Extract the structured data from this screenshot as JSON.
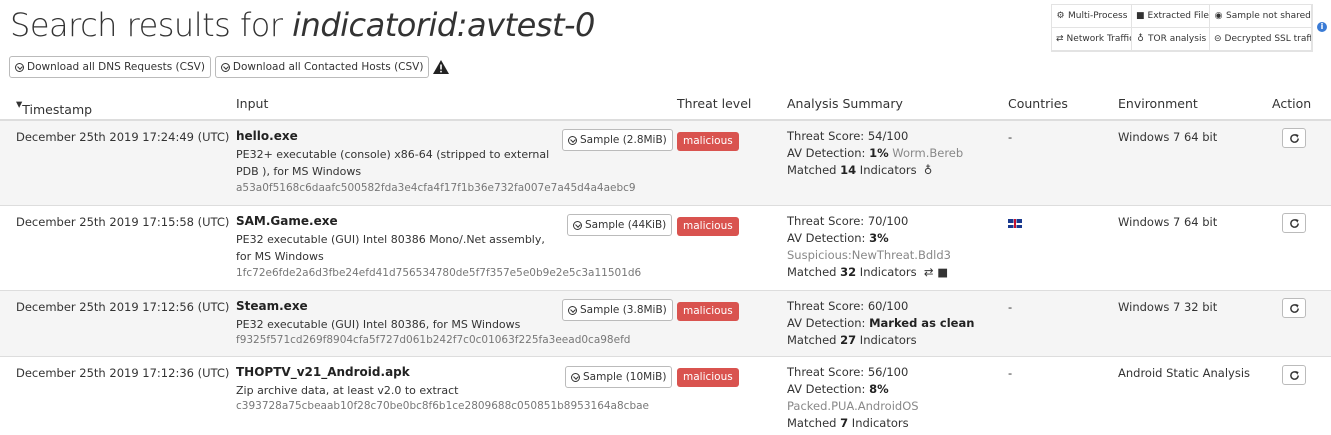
{
  "page": {
    "title_prefix": "Search results for ",
    "title_query": "indicatorid:avtest-0"
  },
  "toolbar": {
    "dns_button": "Download all DNS Requests (CSV)",
    "hosts_button": "Download all Contacted Hosts (CSV)"
  },
  "filters": [
    {
      "label": "Multi-Process",
      "icon": "gears-icon"
    },
    {
      "label": "Extracted Files",
      "icon": "file-icon"
    },
    {
      "label": "Sample not shared",
      "icon": "eye-slash-icon"
    },
    {
      "label": "Network Traffic",
      "icon": "exchange-icon"
    },
    {
      "label": "TOR analysis",
      "icon": "onion-icon"
    },
    {
      "label": "Decrypted SSL traffic",
      "icon": "lock-icon"
    }
  ],
  "table": {
    "headers": {
      "timestamp": "Timestamp",
      "input": "Input",
      "threat": "Threat level",
      "summary": "Analysis Summary",
      "countries": "Countries",
      "environment": "Environment",
      "action": "Action"
    },
    "rows": [
      {
        "timestamp": "December 25th 2019 17:24:49 (UTC)",
        "name": "hello.exe",
        "sample": "Sample (2.8MiB)",
        "desc": "PE32+ executable (console) x86-64 (stripped to external PDB ), for MS Windows",
        "hash": "a53a0f5168c6daafc500582fda3e4cfa4f17f1b36e732fa007e7a45d4a4aebc9",
        "threat": "malicious",
        "score_label": "Threat Score: ",
        "score": "54/100",
        "av_label": "AV Detection: ",
        "av": "1%",
        "av_extra": "Worm.Bereb",
        "matched_pre": "Matched ",
        "matched": "14",
        "matched_post": " Indicators",
        "country": "-",
        "env": "Windows 7 64 bit"
      },
      {
        "timestamp": "December 25th 2019 17:15:58 (UTC)",
        "name": "SAM.Game.exe",
        "sample": "Sample (44KiB)",
        "desc": "PE32 executable (GUI) Intel 80386 Mono/.Net assembly, for MS Windows",
        "hash": "1fc72e6fde2a6d3fbe24efd41d756534780de5f7f357e5e0b9e2e5c3a11501d6",
        "threat": "malicious",
        "score_label": "Threat Score: ",
        "score": "70/100",
        "av_label": "AV Detection: ",
        "av": "3%",
        "av_extra": "Suspicious:NewThreat.Bdld3",
        "matched_pre": "Matched ",
        "matched": "32",
        "matched_post": " Indicators",
        "country": "",
        "env": "Windows 7 64 bit"
      },
      {
        "timestamp": "December 25th 2019 17:12:56 (UTC)",
        "name": "Steam.exe",
        "sample": "Sample (3.8MiB)",
        "desc": "PE32 executable (GUI) Intel 80386, for MS Windows",
        "hash": "f9325f571cd269f8904cfa5f727d061b242f7c0c01063f225fa3eead0ca98efd",
        "threat": "malicious",
        "score_label": "Threat Score: ",
        "score": "60/100",
        "av_label": "AV Detection: ",
        "av": "Marked as clean",
        "av_extra": "",
        "matched_pre": "Matched ",
        "matched": "27",
        "matched_post": " Indicators",
        "country": "-",
        "env": "Windows 7 32 bit"
      },
      {
        "timestamp": "December 25th 2019 17:12:36 (UTC)",
        "name": "THOPTV_v21_Android.apk",
        "sample": "Sample (10MiB)",
        "desc": "Zip archive data, at least v2.0 to extract",
        "hash": "c393728a75cbeaab10f28c70be0bc8f6b1ce2809688c050851b8953164a8cbae",
        "threat": "malicious",
        "score_label": "Threat Score: ",
        "score": "56/100",
        "av_label": "AV Detection: ",
        "av": "8%",
        "av_extra": "Packed.PUA.AndroidOS",
        "matched_pre": "Matched ",
        "matched": "7",
        "matched_post": " Indicators",
        "country": "-",
        "env": "Android Static Analysis"
      }
    ]
  },
  "colors": {
    "malicious": "#d9534f",
    "info": "#3a7bd5"
  }
}
